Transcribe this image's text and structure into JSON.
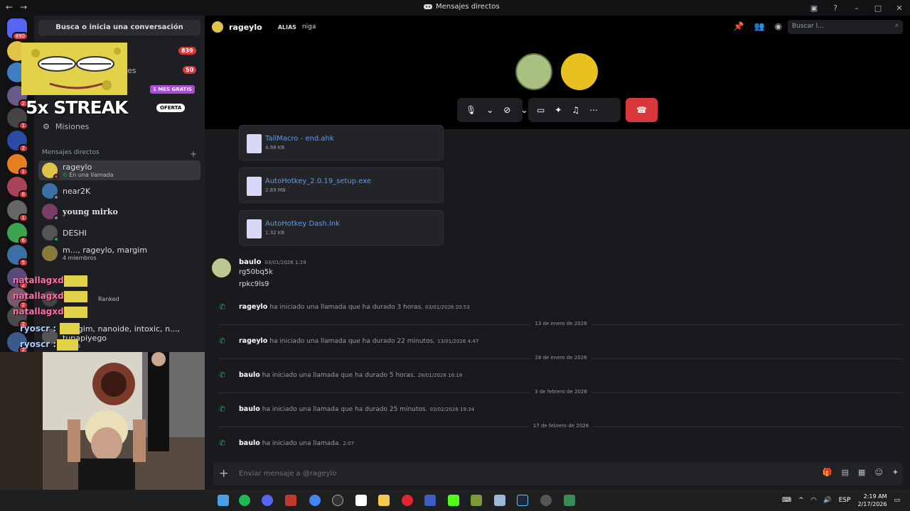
{
  "window": {
    "title": "Mensajes directos"
  },
  "servers": {
    "home_badge": "890",
    "badges": [
      "2",
      "1",
      "2",
      "1",
      "8",
      "1",
      "6",
      "5",
      "2",
      "2",
      "2",
      "2"
    ]
  },
  "sidebar": {
    "search_label": "Busca o inicia una conversación",
    "badge_1": "839",
    "badge_2": "50",
    "partial_text": "es",
    "promo_label": "1 MES GRATIS",
    "offer_label": "OFERTA",
    "quests_label": "Misiones",
    "dm_header": "Mensajes directos",
    "add_icon": "+",
    "dms": [
      {
        "name": "rageylo",
        "sub": "En una llamada"
      },
      {
        "name": "near2K",
        "sub": ""
      },
      {
        "name": "young mirko",
        "sub": ""
      },
      {
        "name": "DESHI",
        "sub": ""
      },
      {
        "name": "m..., rageylo, margim",
        "sub": "4 miembros"
      },
      {
        "name": "",
        "sub": "Ranked"
      },
      {
        "name": "margim, nanoide, intoxic, n..., tupapiyego",
        "sub": "mbros"
      }
    ]
  },
  "overlay": {
    "streak": "5x STREAK",
    "chat": [
      "natallagxd :",
      "natallagxd :",
      "natallagxd :",
      "ryoscr :",
      "ryoscr :"
    ]
  },
  "call": {
    "user": "rageylo",
    "alias_label": "ALIAS",
    "alias_value": "niga",
    "search_placeholder": "Buscar l..."
  },
  "messages": {
    "files": [
      {
        "name": "TallMacro - end.ahk",
        "size": "4.98 KB"
      },
      {
        "name": "AutoHotkey_2.0.19_setup.exe",
        "size": "2.89 MB"
      },
      {
        "name": "AutoHotkey Dash.lnk",
        "size": "1.32 KB"
      }
    ],
    "author": "baulo",
    "author_time": "03/01/2026 1:19",
    "lines": [
      "rg50bq5k",
      "rpkc9ls9"
    ],
    "system": [
      {
        "user": "rageylo",
        "text": "ha iniciado una llamada que ha durado 3 horas.",
        "time": "03/01/2026 20:53"
      },
      {
        "user": "rageylo",
        "text": "ha iniciado una llamada que ha durado 22 minutos.",
        "time": "13/01/2026 4:47"
      },
      {
        "user": "baulo",
        "text": "ha iniciado una llamada que ha durado 5 horas.",
        "time": "28/01/2026 16:18"
      },
      {
        "user": "baulo",
        "text": "ha iniciado una llamada que ha durado 25 minutos.",
        "time": "03/02/2026 19:34"
      },
      {
        "user": "baulo",
        "text": "ha iniciado una llamada.",
        "time": "2:07"
      }
    ],
    "dividers": [
      "13 de enero de 2026",
      "28 de enero de 2026",
      "3 de febrero de 2026",
      "17 de febrero de 2026"
    ]
  },
  "composer": {
    "placeholder": "Enviar mensaje a @rageylo"
  },
  "taskbar": {
    "lang": "ESP",
    "time": "2:19 AM",
    "date": "2/17/2026"
  }
}
